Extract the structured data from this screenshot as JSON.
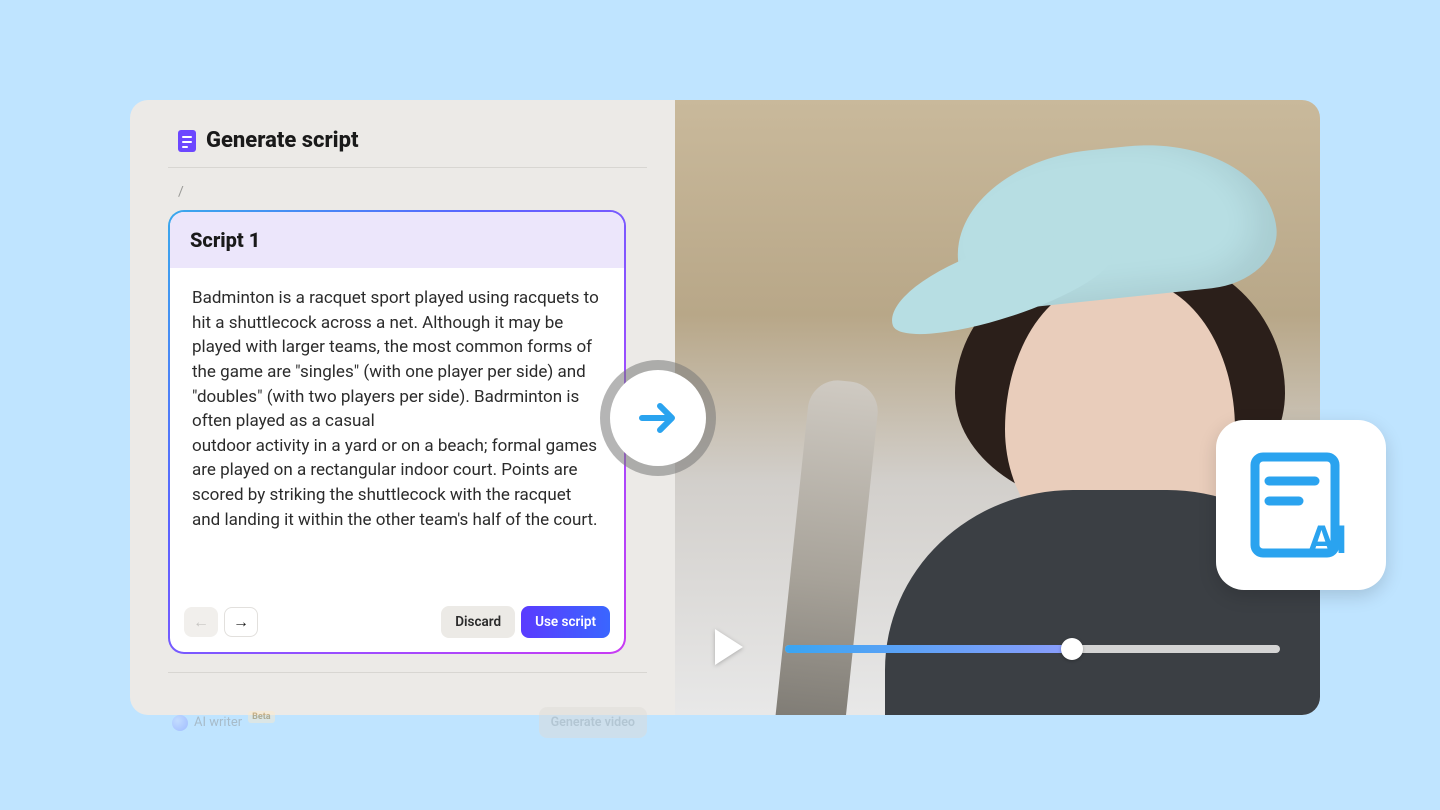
{
  "panel": {
    "title": "Generate script",
    "breadcrumb": "/"
  },
  "script": {
    "heading": "Script 1",
    "body": "Badminton is a racquet sport played using racquets to hit a shuttlecock across a net. Although it may be played with larger teams, the most common forms of the game are \"singles\" (with one player per side) and \"doubles\" (with two players per side). Badrminton is often played as a casual\noutdoor activity in a yard or on a beach; formal games are played on a rectangular indoor court. Points are scored by striking the shuttlecock with the racquet and landing it within the other team's half of the court.",
    "discard_label": "Discard",
    "use_label": "Use script"
  },
  "footer": {
    "ai_writer_label": "AI writer",
    "beta_label": "Beta",
    "generate_label": "Generate video"
  },
  "video": {
    "progress_percent": 58
  }
}
